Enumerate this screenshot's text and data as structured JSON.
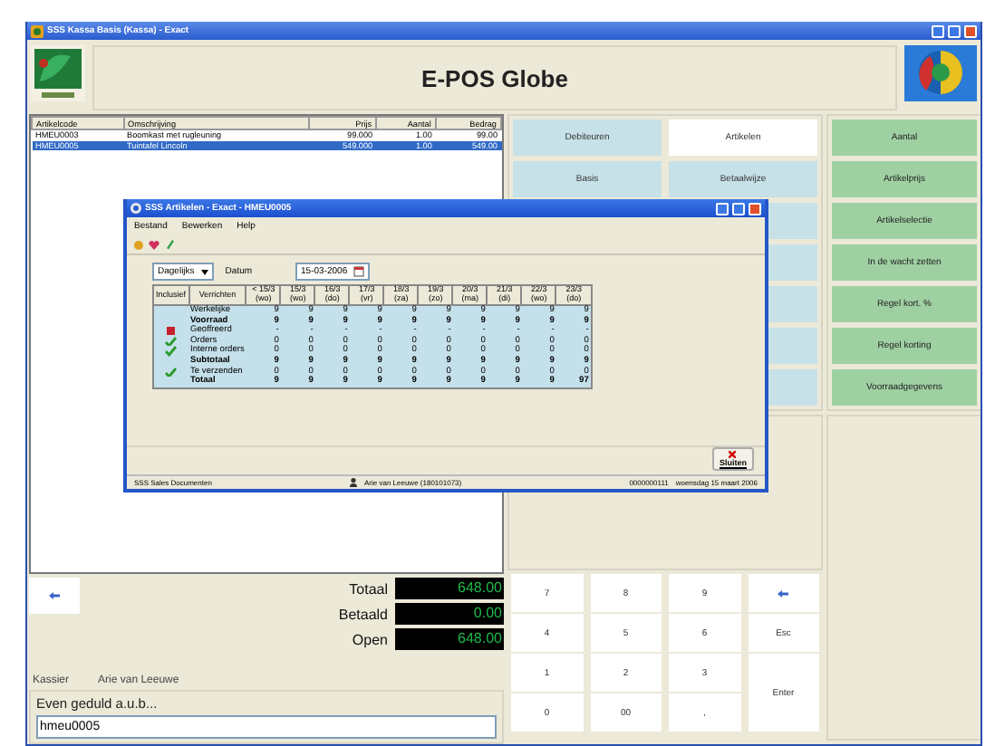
{
  "window": {
    "title": "SSS Kassa Basis (Kassa) - Exact"
  },
  "header": {
    "title": "E-POS Globe"
  },
  "order_list": {
    "columns": [
      "Artikelcode",
      "Omschrijving",
      "Prijs",
      "Aantal",
      "Bedrag"
    ],
    "rows": [
      {
        "cells": [
          "HMEU0003",
          "Boomkast met rugleuning",
          "99.000",
          "1.00",
          "99.00"
        ],
        "selected": false
      },
      {
        "cells": [
          "HMEU0005",
          "Tuintafel Lincoln",
          "549.000",
          "1.00",
          "549.00"
        ],
        "selected": true
      }
    ]
  },
  "totals": [
    {
      "label": "Totaal",
      "value": "648.00"
    },
    {
      "label": "Betaald",
      "value": "0.00"
    },
    {
      "label": "Open",
      "value": "648.00"
    }
  ],
  "cashier": {
    "label": "Kassier",
    "name": "Arie van Leeuwe"
  },
  "message": "Even geduld a.u.b...",
  "input": {
    "value": "hmeu0005"
  },
  "menu_buttons": [
    {
      "label": "Debiteuren",
      "selected": false
    },
    {
      "label": "Artikelen",
      "selected": true
    },
    {
      "label": "Basis",
      "selected": false
    },
    {
      "label": "Betaalwijze",
      "selected": false
    }
  ],
  "action_buttons": [
    "Aantal",
    "Artikelprijs",
    "Artikelselectie",
    "In de wacht zetten",
    "Regel kort. %",
    "Regel korting",
    "Voorraadgegevens"
  ],
  "keypad": [
    {
      "kind": "digit",
      "label": "7"
    },
    {
      "kind": "digit",
      "label": "8"
    },
    {
      "kind": "digit",
      "label": "9"
    },
    {
      "kind": "back"
    },
    {
      "kind": "digit",
      "label": "4"
    },
    {
      "kind": "digit",
      "label": "5"
    },
    {
      "kind": "digit",
      "label": "6"
    },
    {
      "kind": "command",
      "label": "Esc"
    },
    {
      "kind": "digit",
      "label": "1"
    },
    {
      "kind": "digit",
      "label": "2"
    },
    {
      "kind": "digit",
      "label": "3"
    },
    {
      "kind": "enter",
      "label": "Enter"
    },
    {
      "kind": "digit",
      "label": "0"
    },
    {
      "kind": "digit",
      "label": "00"
    },
    {
      "kind": "digit",
      "label": ","
    }
  ],
  "dialog": {
    "title": "SSS Artikelen - Exact - HMEU0005",
    "menu": [
      "Bestand",
      "Bewerken",
      "Help"
    ],
    "period": "Dagelijks",
    "date_label": "Datum",
    "date": "15-03-2006",
    "columns": [
      {
        "date": "Inclusief"
      },
      {
        "date": "Verrichten"
      },
      {
        "date": "< 15/3",
        "day": "(wo)"
      },
      {
        "date": "15/3",
        "day": "(wo)"
      },
      {
        "date": "16/3",
        "day": "(do)"
      },
      {
        "date": "17/3",
        "day": "(vr)"
      },
      {
        "date": "18/3",
        "day": "(za)"
      },
      {
        "date": "19/3",
        "day": "(zo)"
      },
      {
        "date": "20/3",
        "day": "(ma)"
      },
      {
        "date": "21/3",
        "day": "(di)"
      },
      {
        "date": "22/3",
        "day": "(wo)"
      },
      {
        "date": "23/3",
        "day": "(do)"
      }
    ],
    "rows": [
      {
        "kind": "blank",
        "label": "Werkelijke",
        "bold": false,
        "values": [
          "9",
          "9",
          "9",
          "9",
          "9",
          "9",
          "9",
          "9",
          "9",
          "9"
        ]
      },
      {
        "kind": "blank",
        "label": "Voorraad",
        "bold": true,
        "values": [
          "9",
          "9",
          "9",
          "9",
          "9",
          "9",
          "9",
          "9",
          "9",
          "9"
        ]
      },
      {
        "kind": "stop",
        "label": "Geoffreerd",
        "bold": false,
        "values": [
          "-",
          "-",
          "-",
          "-",
          "-",
          "-",
          "-",
          "-",
          "-",
          "-"
        ]
      },
      {
        "kind": "check",
        "label": "Orders",
        "bold": false,
        "values": [
          "0",
          "0",
          "0",
          "0",
          "0",
          "0",
          "0",
          "0",
          "0",
          "0"
        ]
      },
      {
        "kind": "check",
        "label": "Interne orders",
        "bold": false,
        "values": [
          "0",
          "0",
          "0",
          "0",
          "0",
          "0",
          "0",
          "0",
          "0",
          "0"
        ]
      },
      {
        "kind": "blank",
        "label": "Subtotaal",
        "bold": true,
        "values": [
          "9",
          "9",
          "9",
          "9",
          "9",
          "9",
          "9",
          "9",
          "9",
          "9"
        ]
      },
      {
        "kind": "check",
        "label": "Te verzenden",
        "bold": false,
        "values": [
          "0",
          "0",
          "0",
          "0",
          "0",
          "0",
          "0",
          "0",
          "0",
          "0"
        ]
      },
      {
        "kind": "blank",
        "label": "Totaal",
        "bold": true,
        "values": [
          "9",
          "9",
          "9",
          "9",
          "9",
          "9",
          "9",
          "9",
          "9",
          "97"
        ]
      }
    ],
    "close_button": "Sluiten",
    "status_bar": [
      "SSS Sales Documenten",
      "Arie van Leeuwe (180101073)",
      "0000000111",
      "woensdag 15 maart 2006"
    ]
  }
}
